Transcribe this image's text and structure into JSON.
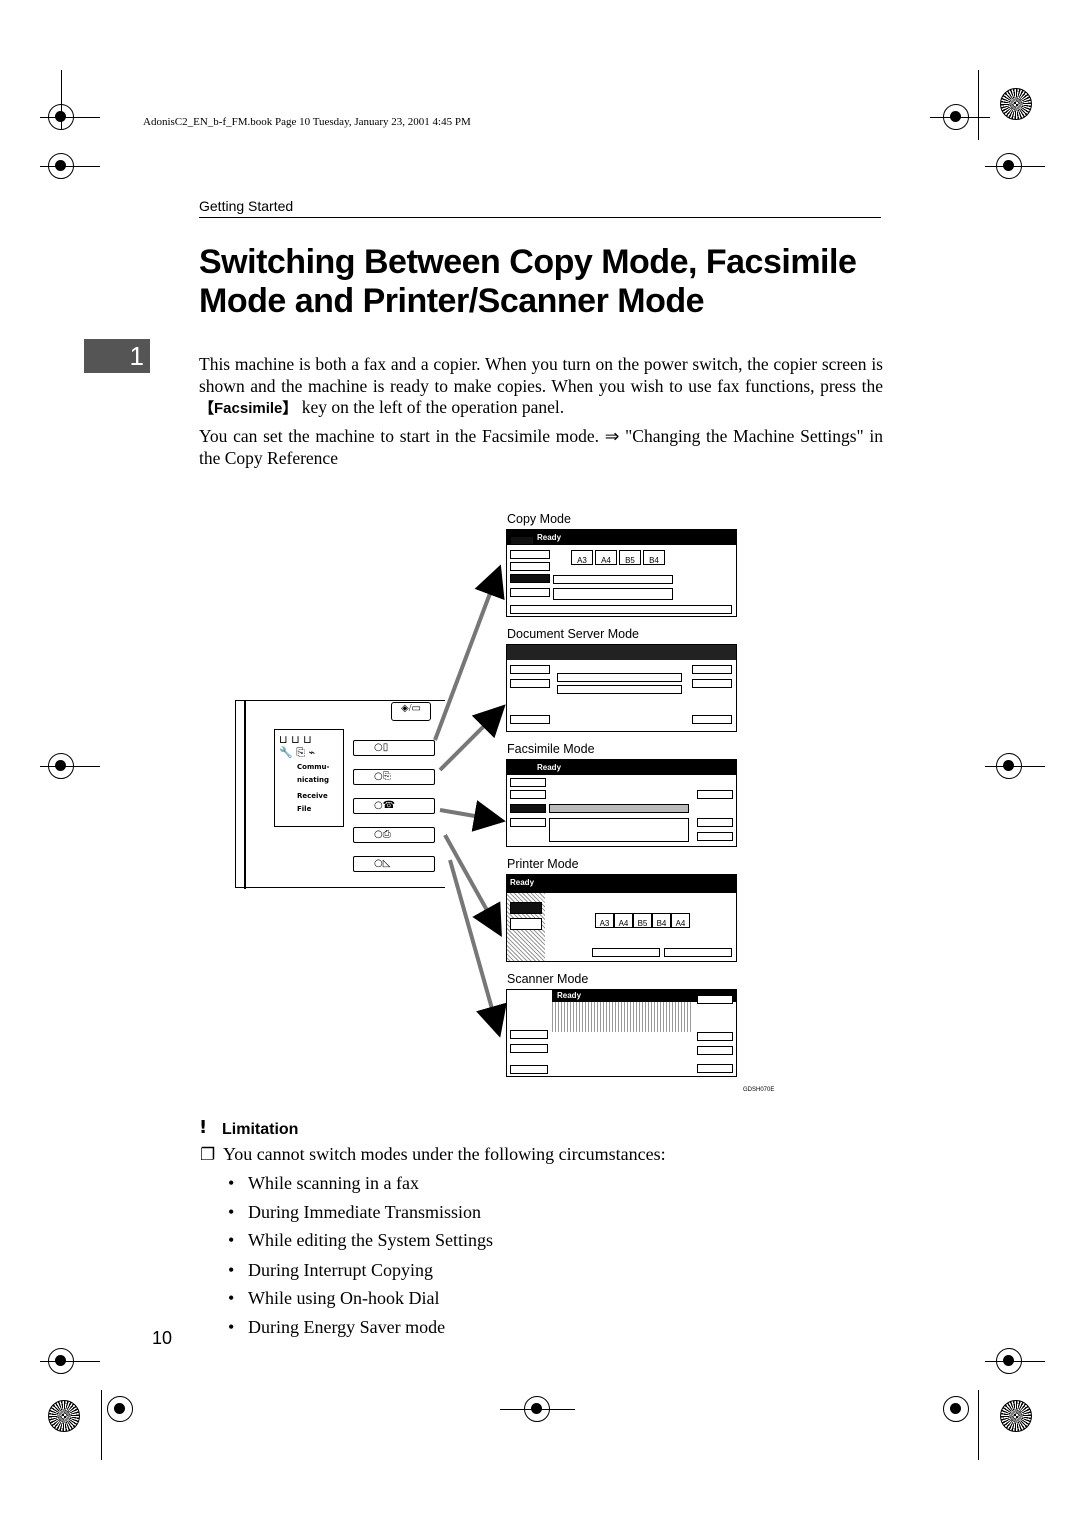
{
  "header_info": "AdonisC2_EN_b-f_FM.book  Page 10  Tuesday, January 23, 2001  4:45 PM",
  "section": "Getting Started",
  "title": "Switching Between Copy Mode, Facsimile Mode and Printer/Scanner Mode",
  "chapter_tab": "1",
  "para1_a": "This machine is both a fax and a copier. When you turn on the power switch, the copier screen is shown and the machine is ready to make copies. When you wish to use fax functions, press the ",
  "para1_key": "【Facsimile】",
  "para1_b": " key on the left of the operation panel.",
  "para2": "You can set the machine to start in the Facsimile mode. ⇒ \"Changing the Machine Settings\" in the Copy Reference",
  "figure": {
    "panel_labels": {
      "communicating": "Commu-\nnicating",
      "receive_file": "Receive File"
    },
    "modes": [
      {
        "label": "Copy Mode",
        "status": "Ready",
        "sizes": [
          "A3",
          "A4",
          "B5",
          "B4"
        ]
      },
      {
        "label": "Document Server Mode",
        "status": "",
        "sizes": []
      },
      {
        "label": "Facsimile Mode",
        "status": "Ready",
        "sizes": []
      },
      {
        "label": "Printer Mode",
        "status": "Ready",
        "sizes": [
          "A3",
          "A4",
          "B5",
          "B4",
          "A4"
        ]
      },
      {
        "label": "Scanner Mode",
        "status": "Ready",
        "sizes": []
      }
    ],
    "code": "GDSH070E"
  },
  "limitation": {
    "heading": "Limitation",
    "intro": "You cannot switch modes under the following circumstances:",
    "items": [
      "While scanning in a fax",
      "During Immediate Transmission",
      "While editing the System Settings",
      "During Interrupt Copying",
      "While using On-hook Dial",
      "During Energy Saver mode"
    ]
  },
  "page_number": "10"
}
